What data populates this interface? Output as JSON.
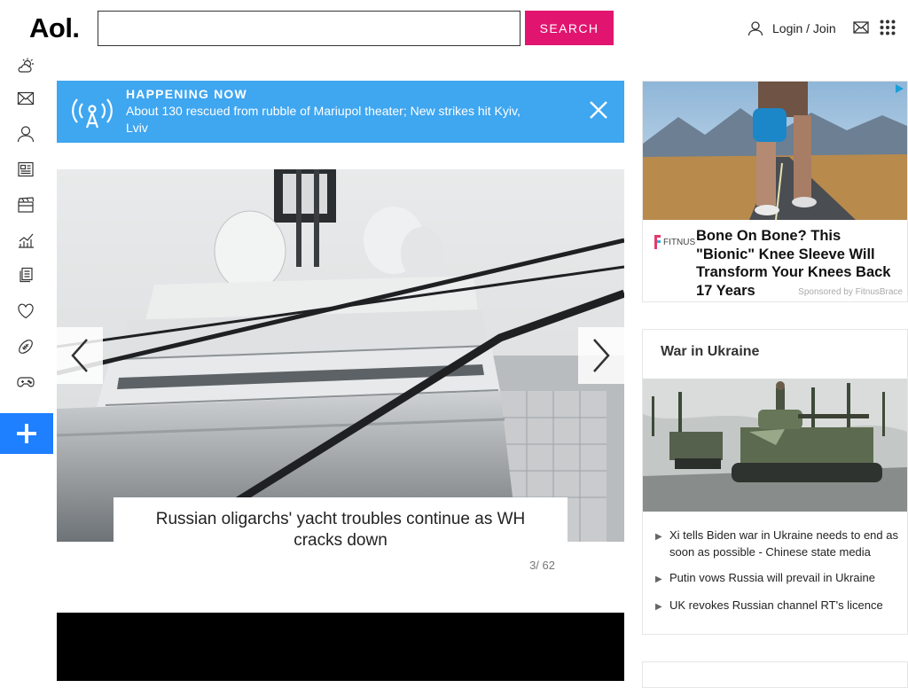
{
  "header": {
    "logo": "Aol.",
    "search": {
      "placeholder": "",
      "value": "",
      "button_label": "SEARCH"
    },
    "login_label": "Login / Join"
  },
  "left_rail": {
    "icons": [
      "weather-icon",
      "mail-icon",
      "user-icon",
      "news-icon",
      "entertainment-icon",
      "finance-icon",
      "lifestyle-icon",
      "health-icon",
      "sports-icon",
      "games-icon"
    ]
  },
  "happening_now": {
    "title": "HAPPENING NOW",
    "text": "About 130 rescued from rubble of Mariupol theater; New strikes hit Kyiv, Lviv"
  },
  "slideshow": {
    "caption": "Russian oligarchs' yacht troubles continue as WH cracks down",
    "counter": "3/ 62"
  },
  "ad": {
    "brand": "FITNUS",
    "headline": "Bone On Bone? This \"Bionic\" Knee Sleeve Will Transform Your Knees Back 17 Years",
    "sponsor": "Sponsored by FitnusBrace"
  },
  "war": {
    "title": "War in Ukraine",
    "items": [
      "Xi tells Biden war in Ukraine needs to end as soon as possible - Chinese state media",
      "Putin vows Russia will prevail in Ukraine",
      "UK revokes Russian channel RT's licence"
    ]
  },
  "colors": {
    "accent": "#e1156f",
    "banner": "#3fa6f0",
    "plus": "#1e7fff"
  }
}
